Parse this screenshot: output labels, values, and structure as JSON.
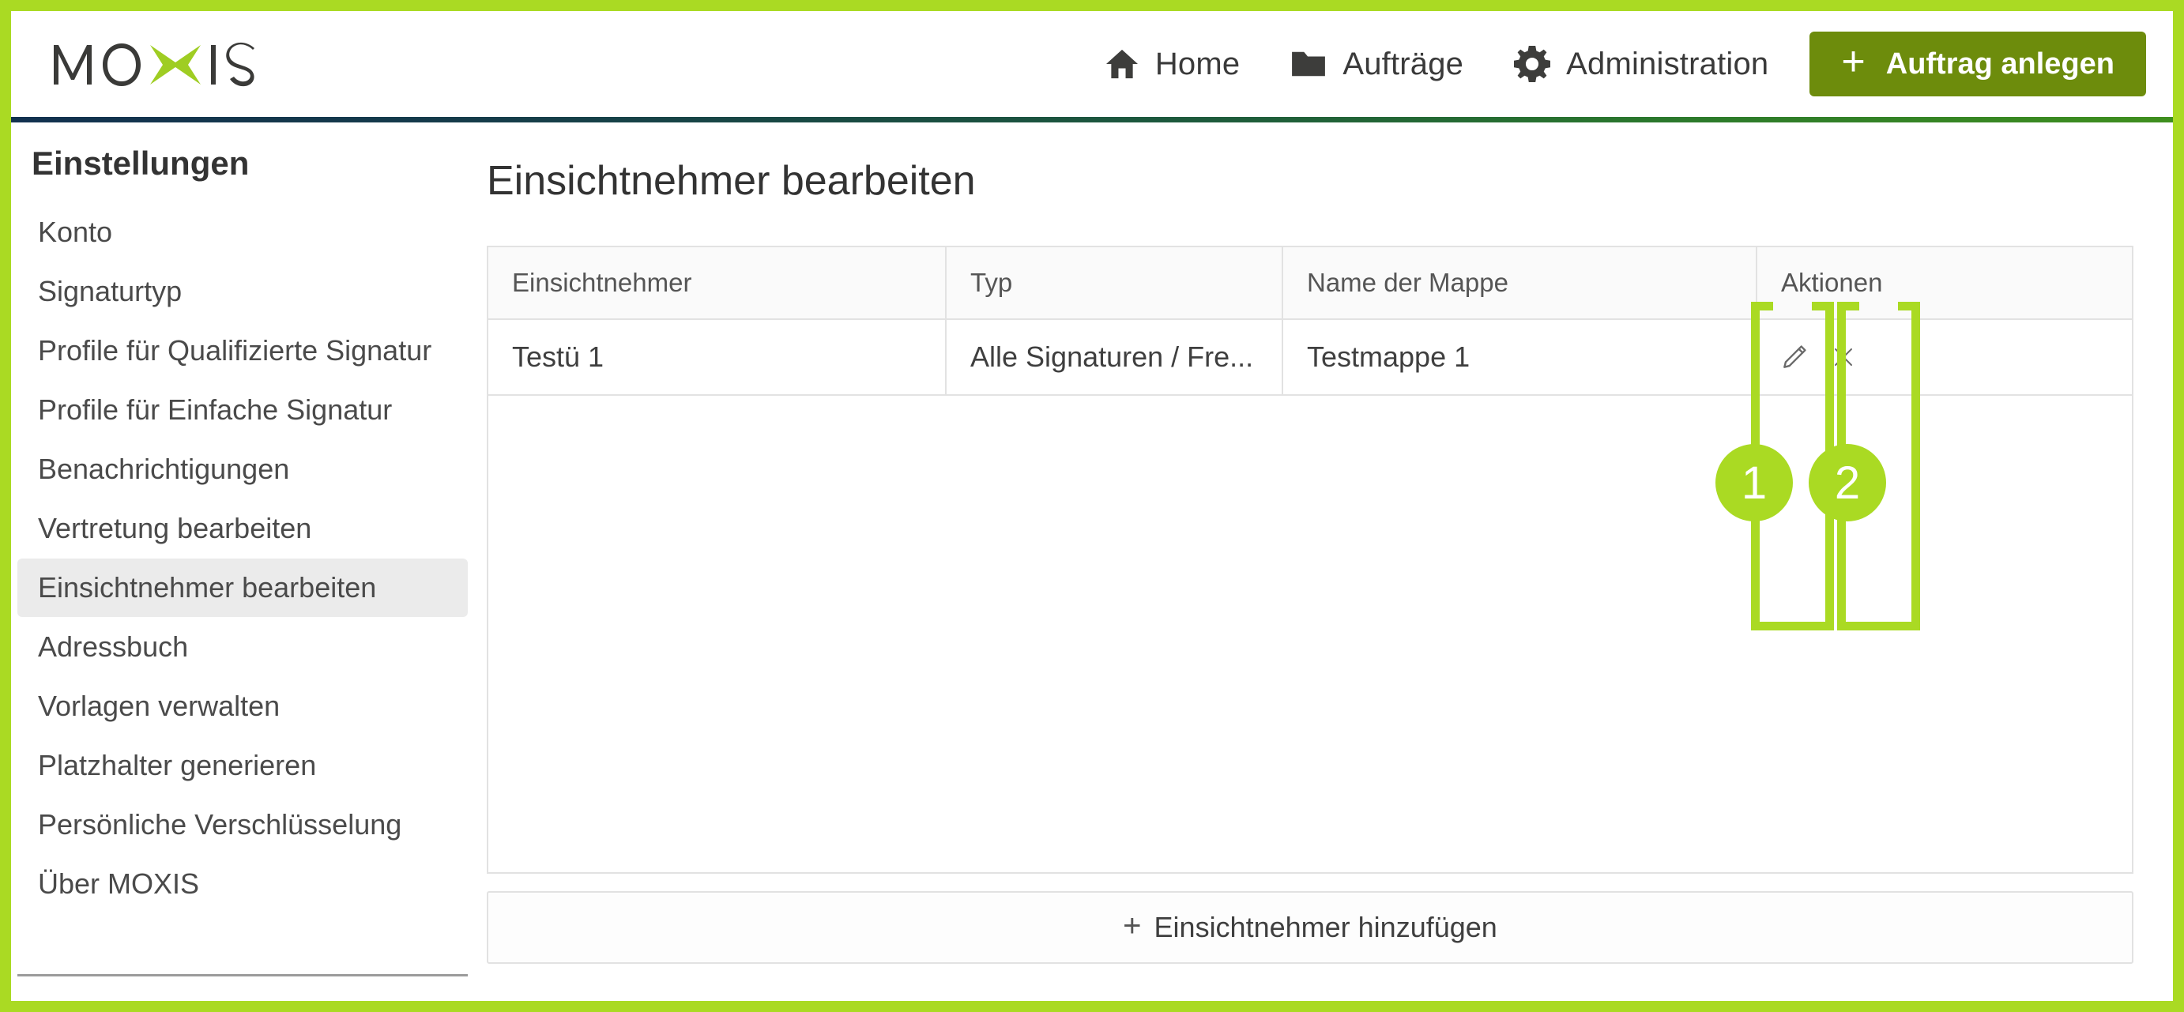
{
  "brand": {
    "logo_text": "MOXIS",
    "accent_green": "#aada23",
    "button_green": "#6d8c0c"
  },
  "header": {
    "nav": [
      {
        "label": "Home",
        "icon": "home-icon"
      },
      {
        "label": "Aufträge",
        "icon": "folder-icon"
      },
      {
        "label": "Administration",
        "icon": "gear-icon"
      }
    ],
    "cta": {
      "label": "Auftrag anlegen",
      "icon": "plus-icon"
    }
  },
  "sidebar": {
    "title": "Einstellungen",
    "items": [
      {
        "label": "Konto",
        "active": false
      },
      {
        "label": "Signaturtyp",
        "active": false
      },
      {
        "label": "Profile für Qualifizierte Signatur",
        "active": false
      },
      {
        "label": "Profile für Einfache Signatur",
        "active": false
      },
      {
        "label": "Benachrichtigungen",
        "active": false
      },
      {
        "label": "Vertretung bearbeiten",
        "active": false
      },
      {
        "label": "Einsichtnehmer bearbeiten",
        "active": true
      },
      {
        "label": "Adressbuch",
        "active": false
      },
      {
        "label": "Vorlagen verwalten",
        "active": false
      },
      {
        "label": "Platzhalter generieren",
        "active": false
      },
      {
        "label": "Persönliche Verschlüsselung",
        "active": false
      },
      {
        "label": "Über MOXIS",
        "active": false
      }
    ]
  },
  "main": {
    "page_title": "Einsichtnehmer bearbeiten",
    "table": {
      "columns": [
        "Einsichtnehmer",
        "Typ",
        "Name der Mappe",
        "Aktionen"
      ],
      "rows": [
        {
          "einsichtnehmer": "Testü 1",
          "typ": "Alle Signaturen / Fre...",
          "mappe": "Testmappe 1",
          "actions": [
            "edit-pencil-icon",
            "delete-x-icon"
          ]
        }
      ]
    },
    "add_button": {
      "label": "Einsichtnehmer hinzufügen",
      "icon": "plus-icon"
    }
  },
  "annotations": [
    {
      "number": "1",
      "target": "edit-pencil-icon"
    },
    {
      "number": "2",
      "target": "delete-x-icon"
    }
  ]
}
